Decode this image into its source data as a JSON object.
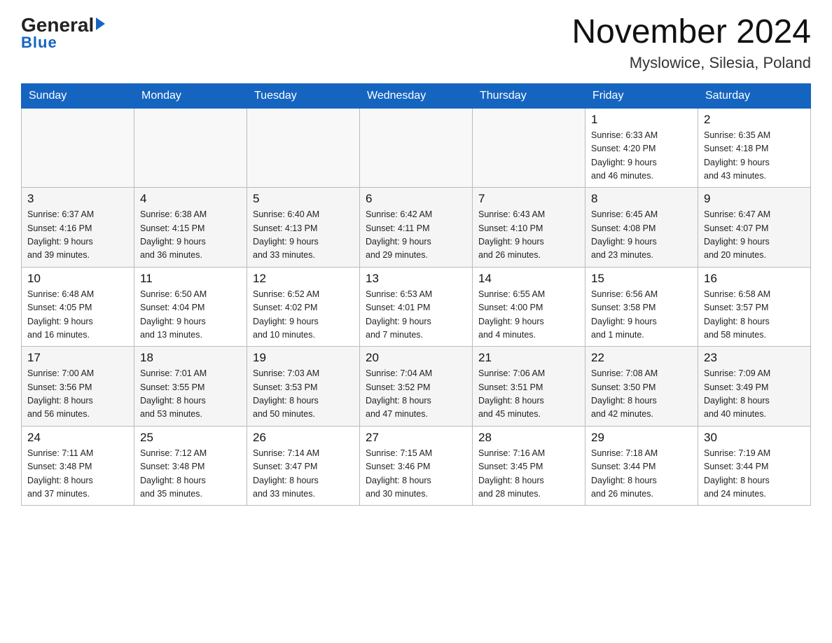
{
  "header": {
    "logo_line1": "General",
    "logo_triangle": "▶",
    "logo_line2": "Blue",
    "title": "November 2024",
    "subtitle": "Myslowice, Silesia, Poland"
  },
  "days_of_week": [
    "Sunday",
    "Monday",
    "Tuesday",
    "Wednesday",
    "Thursday",
    "Friday",
    "Saturday"
  ],
  "weeks": [
    [
      {
        "day": "",
        "info": ""
      },
      {
        "day": "",
        "info": ""
      },
      {
        "day": "",
        "info": ""
      },
      {
        "day": "",
        "info": ""
      },
      {
        "day": "",
        "info": ""
      },
      {
        "day": "1",
        "info": "Sunrise: 6:33 AM\nSunset: 4:20 PM\nDaylight: 9 hours\nand 46 minutes."
      },
      {
        "day": "2",
        "info": "Sunrise: 6:35 AM\nSunset: 4:18 PM\nDaylight: 9 hours\nand 43 minutes."
      }
    ],
    [
      {
        "day": "3",
        "info": "Sunrise: 6:37 AM\nSunset: 4:16 PM\nDaylight: 9 hours\nand 39 minutes."
      },
      {
        "day": "4",
        "info": "Sunrise: 6:38 AM\nSunset: 4:15 PM\nDaylight: 9 hours\nand 36 minutes."
      },
      {
        "day": "5",
        "info": "Sunrise: 6:40 AM\nSunset: 4:13 PM\nDaylight: 9 hours\nand 33 minutes."
      },
      {
        "day": "6",
        "info": "Sunrise: 6:42 AM\nSunset: 4:11 PM\nDaylight: 9 hours\nand 29 minutes."
      },
      {
        "day": "7",
        "info": "Sunrise: 6:43 AM\nSunset: 4:10 PM\nDaylight: 9 hours\nand 26 minutes."
      },
      {
        "day": "8",
        "info": "Sunrise: 6:45 AM\nSunset: 4:08 PM\nDaylight: 9 hours\nand 23 minutes."
      },
      {
        "day": "9",
        "info": "Sunrise: 6:47 AM\nSunset: 4:07 PM\nDaylight: 9 hours\nand 20 minutes."
      }
    ],
    [
      {
        "day": "10",
        "info": "Sunrise: 6:48 AM\nSunset: 4:05 PM\nDaylight: 9 hours\nand 16 minutes."
      },
      {
        "day": "11",
        "info": "Sunrise: 6:50 AM\nSunset: 4:04 PM\nDaylight: 9 hours\nand 13 minutes."
      },
      {
        "day": "12",
        "info": "Sunrise: 6:52 AM\nSunset: 4:02 PM\nDaylight: 9 hours\nand 10 minutes."
      },
      {
        "day": "13",
        "info": "Sunrise: 6:53 AM\nSunset: 4:01 PM\nDaylight: 9 hours\nand 7 minutes."
      },
      {
        "day": "14",
        "info": "Sunrise: 6:55 AM\nSunset: 4:00 PM\nDaylight: 9 hours\nand 4 minutes."
      },
      {
        "day": "15",
        "info": "Sunrise: 6:56 AM\nSunset: 3:58 PM\nDaylight: 9 hours\nand 1 minute."
      },
      {
        "day": "16",
        "info": "Sunrise: 6:58 AM\nSunset: 3:57 PM\nDaylight: 8 hours\nand 58 minutes."
      }
    ],
    [
      {
        "day": "17",
        "info": "Sunrise: 7:00 AM\nSunset: 3:56 PM\nDaylight: 8 hours\nand 56 minutes."
      },
      {
        "day": "18",
        "info": "Sunrise: 7:01 AM\nSunset: 3:55 PM\nDaylight: 8 hours\nand 53 minutes."
      },
      {
        "day": "19",
        "info": "Sunrise: 7:03 AM\nSunset: 3:53 PM\nDaylight: 8 hours\nand 50 minutes."
      },
      {
        "day": "20",
        "info": "Sunrise: 7:04 AM\nSunset: 3:52 PM\nDaylight: 8 hours\nand 47 minutes."
      },
      {
        "day": "21",
        "info": "Sunrise: 7:06 AM\nSunset: 3:51 PM\nDaylight: 8 hours\nand 45 minutes."
      },
      {
        "day": "22",
        "info": "Sunrise: 7:08 AM\nSunset: 3:50 PM\nDaylight: 8 hours\nand 42 minutes."
      },
      {
        "day": "23",
        "info": "Sunrise: 7:09 AM\nSunset: 3:49 PM\nDaylight: 8 hours\nand 40 minutes."
      }
    ],
    [
      {
        "day": "24",
        "info": "Sunrise: 7:11 AM\nSunset: 3:48 PM\nDaylight: 8 hours\nand 37 minutes."
      },
      {
        "day": "25",
        "info": "Sunrise: 7:12 AM\nSunset: 3:48 PM\nDaylight: 8 hours\nand 35 minutes."
      },
      {
        "day": "26",
        "info": "Sunrise: 7:14 AM\nSunset: 3:47 PM\nDaylight: 8 hours\nand 33 minutes."
      },
      {
        "day": "27",
        "info": "Sunrise: 7:15 AM\nSunset: 3:46 PM\nDaylight: 8 hours\nand 30 minutes."
      },
      {
        "day": "28",
        "info": "Sunrise: 7:16 AM\nSunset: 3:45 PM\nDaylight: 8 hours\nand 28 minutes."
      },
      {
        "day": "29",
        "info": "Sunrise: 7:18 AM\nSunset: 3:44 PM\nDaylight: 8 hours\nand 26 minutes."
      },
      {
        "day": "30",
        "info": "Sunrise: 7:19 AM\nSunset: 3:44 PM\nDaylight: 8 hours\nand 24 minutes."
      }
    ]
  ]
}
